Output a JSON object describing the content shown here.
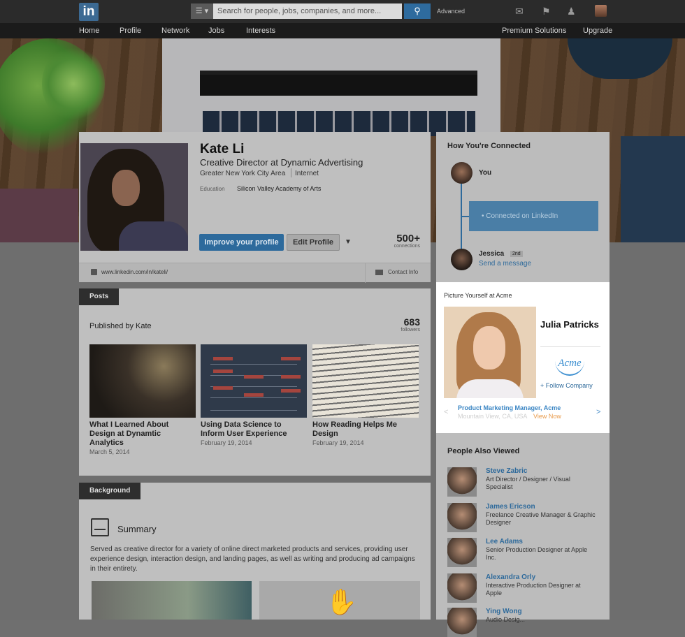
{
  "topbar": {
    "logo": "in",
    "search_placeholder": "Search for people, jobs, companies, and more...",
    "advanced": "Advanced"
  },
  "nav": [
    "Home",
    "Profile",
    "Network",
    "Jobs",
    "Interests",
    "Premium Solutions",
    "Upgrade"
  ],
  "profile": {
    "name": "Kate Li",
    "headline": "Creative Director at Dynamic Advertising",
    "location": "Greater New York City Area",
    "industry": "Internet",
    "education_label": "Education",
    "education": "Silicon Valley Academy of Arts",
    "improve_btn": "Improve your profile",
    "edit_btn": "Edit Profile",
    "connections_count": "500+",
    "connections_label": "connections",
    "url": "www.linkedin.com/in/kateli/",
    "contact_info": "Contact Info"
  },
  "posts": {
    "tab": "Posts",
    "published_by": "Published by Kate",
    "followers_count": "683",
    "followers_label": "followers",
    "items": [
      {
        "title": "What I Learned About Design at Dynamtic Analytics",
        "date": "March 5, 2014"
      },
      {
        "title": "Using Data Science to Inform User Experience",
        "date": "February 19, 2014"
      },
      {
        "title": "How Reading Helps Me Design",
        "date": "February 19, 2014"
      }
    ]
  },
  "background": {
    "tab": "Background",
    "summary_title": "Summary",
    "summary_text": "Served as creative director for a variety of online direct marketed products and services, providing user experience design, interaction design, and landing pages, as well as writing and producing ad campaigns in their entirety."
  },
  "connected": {
    "title": "How You're Connected",
    "you": "You",
    "box": "•  Connected on LinkedIn",
    "jessica": "Jessica",
    "degree": "2nd",
    "send_message": "Send a message"
  },
  "ad": {
    "title": "Picture Yourself at Acme",
    "person_name": "Julia Patricks",
    "logo_text": "Acme",
    "follow": "+ Follow Company",
    "job": "Product Marketing Manager, Acme",
    "location": "Mountain View, CA, USA",
    "view_now": "View Now",
    "prev": "<",
    "next": ">"
  },
  "people_also_viewed": {
    "title": "People Also Viewed",
    "people": [
      {
        "name": "Steve Zabric",
        "desc": "Art Director / Designer / Visual Specialist"
      },
      {
        "name": "James Ericson",
        "desc": "Freelance Creative Manager & Graphic Designer"
      },
      {
        "name": "Lee Adams",
        "desc": "Senior Production Designer at Apple Inc."
      },
      {
        "name": "Alexandra Orly",
        "desc": "Interactive Production Designer at Apple"
      },
      {
        "name": "Ying Wong",
        "desc": "Audio Desig..."
      }
    ]
  },
  "colors": {
    "accent": "#2e6a9b",
    "topbar": "#2b2b2b",
    "ad_link": "#3b86c4",
    "view_now": "#e89a4a"
  },
  "icons": [
    "linkedin-logo",
    "search-icon",
    "mail-icon",
    "flag-icon",
    "add-connection-icon",
    "summary-icon",
    "contact-card-icon",
    "hand-icon"
  ]
}
